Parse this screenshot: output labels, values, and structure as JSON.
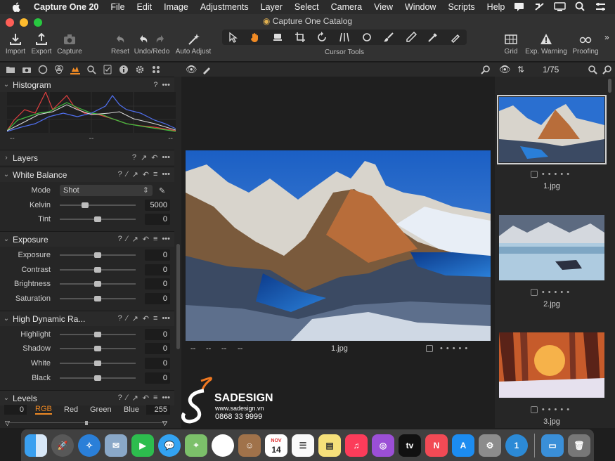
{
  "menubar": {
    "app_name": "Capture One 20",
    "items": [
      "File",
      "Edit",
      "Image",
      "Adjustments",
      "Layer",
      "Select",
      "Camera",
      "View",
      "Window",
      "Scripts",
      "Help"
    ]
  },
  "window": {
    "title": "Capture One Catalog"
  },
  "toolbar": {
    "import": "Import",
    "export": "Export",
    "capture": "Capture",
    "reset": "Reset",
    "undo_redo": "Undo/Redo",
    "auto_adjust": "Auto Adjust",
    "cursor_tools": "Cursor Tools",
    "grid": "Grid",
    "exp_warning": "Exp. Warning",
    "proofing": "Proofing"
  },
  "left_panel": {
    "histogram": {
      "title": "Histogram",
      "labels": [
        "--",
        "--",
        "--"
      ]
    },
    "layers": {
      "title": "Layers"
    },
    "white_balance": {
      "title": "White Balance",
      "mode_label": "Mode",
      "mode_value": "Shot",
      "kelvin_label": "Kelvin",
      "kelvin_value": "5000",
      "kelvin_level": 0.33,
      "tint_label": "Tint",
      "tint_value": "0",
      "tint_level": 0.5
    },
    "exposure": {
      "title": "Exposure",
      "rows": [
        {
          "label": "Exposure",
          "value": "0",
          "level": 0.5
        },
        {
          "label": "Contrast",
          "value": "0",
          "level": 0.5
        },
        {
          "label": "Brightness",
          "value": "0",
          "level": 0.5
        },
        {
          "label": "Saturation",
          "value": "0",
          "level": 0.5
        }
      ]
    },
    "hdr": {
      "title": "High Dynamic Ra...",
      "rows": [
        {
          "label": "Highlight",
          "value": "0",
          "level": 0.5
        },
        {
          "label": "Shadow",
          "value": "0",
          "level": 0.5
        },
        {
          "label": "White",
          "value": "0",
          "level": 0.5
        },
        {
          "label": "Black",
          "value": "0",
          "level": 0.5
        }
      ]
    },
    "levels": {
      "title": "Levels",
      "low": "0",
      "high": "255",
      "channels": [
        "RGB",
        "Red",
        "Green",
        "Blue"
      ]
    }
  },
  "viewer": {
    "filename": "1.jpg",
    "meta": [
      "--",
      "--",
      "--",
      "--"
    ]
  },
  "browser": {
    "counter": "1/75",
    "thumbnails": [
      {
        "name": "1.jpg",
        "selected": true
      },
      {
        "name": "2.jpg",
        "selected": false
      },
      {
        "name": "3.jpg",
        "selected": false
      }
    ]
  },
  "watermark": {
    "brand": "SADESIGN",
    "url": "www.sadesign.vn",
    "phone": "0868 33 9999"
  },
  "dock": {
    "calendar_month": "NOV",
    "calendar_day": "14"
  },
  "colors": {
    "accent": "#f08a24",
    "panel": "#262626",
    "toolbar": "#323232"
  }
}
